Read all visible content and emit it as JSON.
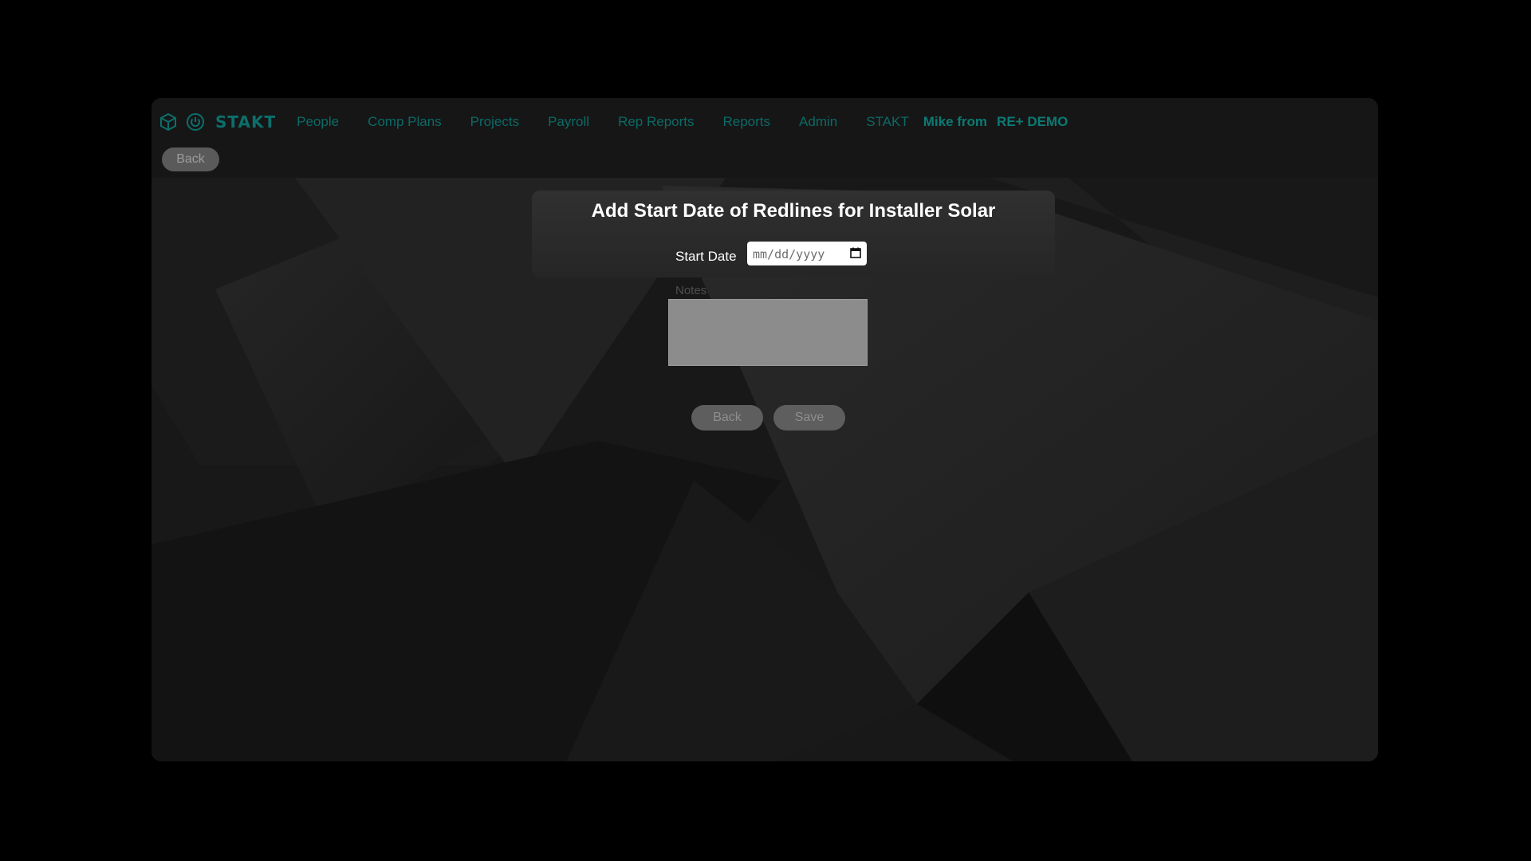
{
  "nav": {
    "brand": "STAKT",
    "items": [
      {
        "label": "People"
      },
      {
        "label": "Comp Plans"
      },
      {
        "label": "Projects"
      },
      {
        "label": "Payroll"
      },
      {
        "label": "Rep Reports"
      },
      {
        "label": "Reports"
      },
      {
        "label": "Admin"
      },
      {
        "label": "STAKT"
      }
    ],
    "user": "Mike from",
    "company": "RE+ DEMO"
  },
  "top_back_label": "Back",
  "form": {
    "title": "Add Start Date of Redlines for Installer Solar",
    "start_date_label": "Start Date",
    "start_date_placeholder": "mm/dd/yyyy",
    "notes_label": "Notes",
    "notes_value": "",
    "back_label": "Back",
    "save_label": "Save"
  },
  "icons": {
    "logo": "stakt-cube-icon",
    "secondary": "power-icon",
    "date": "calendar-icon"
  },
  "colors": {
    "accent": "#0b6f6b",
    "background": "#000000",
    "panel": "#121212"
  }
}
